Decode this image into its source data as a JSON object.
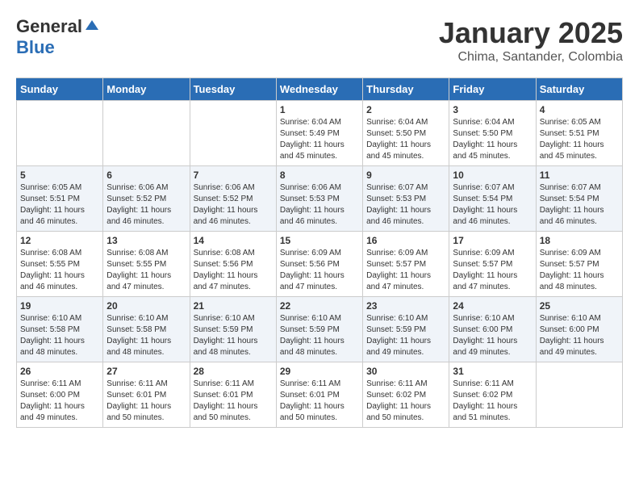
{
  "header": {
    "logo_general": "General",
    "logo_blue": "Blue",
    "title": "January 2025",
    "subtitle": "Chima, Santander, Colombia"
  },
  "days_of_week": [
    "Sunday",
    "Monday",
    "Tuesday",
    "Wednesday",
    "Thursday",
    "Friday",
    "Saturday"
  ],
  "weeks": [
    [
      {
        "day": "",
        "info": ""
      },
      {
        "day": "",
        "info": ""
      },
      {
        "day": "",
        "info": ""
      },
      {
        "day": "1",
        "info": "Sunrise: 6:04 AM\nSunset: 5:49 PM\nDaylight: 11 hours\nand 45 minutes."
      },
      {
        "day": "2",
        "info": "Sunrise: 6:04 AM\nSunset: 5:50 PM\nDaylight: 11 hours\nand 45 minutes."
      },
      {
        "day": "3",
        "info": "Sunrise: 6:04 AM\nSunset: 5:50 PM\nDaylight: 11 hours\nand 45 minutes."
      },
      {
        "day": "4",
        "info": "Sunrise: 6:05 AM\nSunset: 5:51 PM\nDaylight: 11 hours\nand 45 minutes."
      }
    ],
    [
      {
        "day": "5",
        "info": "Sunrise: 6:05 AM\nSunset: 5:51 PM\nDaylight: 11 hours\nand 46 minutes."
      },
      {
        "day": "6",
        "info": "Sunrise: 6:06 AM\nSunset: 5:52 PM\nDaylight: 11 hours\nand 46 minutes."
      },
      {
        "day": "7",
        "info": "Sunrise: 6:06 AM\nSunset: 5:52 PM\nDaylight: 11 hours\nand 46 minutes."
      },
      {
        "day": "8",
        "info": "Sunrise: 6:06 AM\nSunset: 5:53 PM\nDaylight: 11 hours\nand 46 minutes."
      },
      {
        "day": "9",
        "info": "Sunrise: 6:07 AM\nSunset: 5:53 PM\nDaylight: 11 hours\nand 46 minutes."
      },
      {
        "day": "10",
        "info": "Sunrise: 6:07 AM\nSunset: 5:54 PM\nDaylight: 11 hours\nand 46 minutes."
      },
      {
        "day": "11",
        "info": "Sunrise: 6:07 AM\nSunset: 5:54 PM\nDaylight: 11 hours\nand 46 minutes."
      }
    ],
    [
      {
        "day": "12",
        "info": "Sunrise: 6:08 AM\nSunset: 5:55 PM\nDaylight: 11 hours\nand 46 minutes."
      },
      {
        "day": "13",
        "info": "Sunrise: 6:08 AM\nSunset: 5:55 PM\nDaylight: 11 hours\nand 47 minutes."
      },
      {
        "day": "14",
        "info": "Sunrise: 6:08 AM\nSunset: 5:56 PM\nDaylight: 11 hours\nand 47 minutes."
      },
      {
        "day": "15",
        "info": "Sunrise: 6:09 AM\nSunset: 5:56 PM\nDaylight: 11 hours\nand 47 minutes."
      },
      {
        "day": "16",
        "info": "Sunrise: 6:09 AM\nSunset: 5:57 PM\nDaylight: 11 hours\nand 47 minutes."
      },
      {
        "day": "17",
        "info": "Sunrise: 6:09 AM\nSunset: 5:57 PM\nDaylight: 11 hours\nand 47 minutes."
      },
      {
        "day": "18",
        "info": "Sunrise: 6:09 AM\nSunset: 5:57 PM\nDaylight: 11 hours\nand 48 minutes."
      }
    ],
    [
      {
        "day": "19",
        "info": "Sunrise: 6:10 AM\nSunset: 5:58 PM\nDaylight: 11 hours\nand 48 minutes."
      },
      {
        "day": "20",
        "info": "Sunrise: 6:10 AM\nSunset: 5:58 PM\nDaylight: 11 hours\nand 48 minutes."
      },
      {
        "day": "21",
        "info": "Sunrise: 6:10 AM\nSunset: 5:59 PM\nDaylight: 11 hours\nand 48 minutes."
      },
      {
        "day": "22",
        "info": "Sunrise: 6:10 AM\nSunset: 5:59 PM\nDaylight: 11 hours\nand 48 minutes."
      },
      {
        "day": "23",
        "info": "Sunrise: 6:10 AM\nSunset: 5:59 PM\nDaylight: 11 hours\nand 49 minutes."
      },
      {
        "day": "24",
        "info": "Sunrise: 6:10 AM\nSunset: 6:00 PM\nDaylight: 11 hours\nand 49 minutes."
      },
      {
        "day": "25",
        "info": "Sunrise: 6:10 AM\nSunset: 6:00 PM\nDaylight: 11 hours\nand 49 minutes."
      }
    ],
    [
      {
        "day": "26",
        "info": "Sunrise: 6:11 AM\nSunset: 6:00 PM\nDaylight: 11 hours\nand 49 minutes."
      },
      {
        "day": "27",
        "info": "Sunrise: 6:11 AM\nSunset: 6:01 PM\nDaylight: 11 hours\nand 50 minutes."
      },
      {
        "day": "28",
        "info": "Sunrise: 6:11 AM\nSunset: 6:01 PM\nDaylight: 11 hours\nand 50 minutes."
      },
      {
        "day": "29",
        "info": "Sunrise: 6:11 AM\nSunset: 6:01 PM\nDaylight: 11 hours\nand 50 minutes."
      },
      {
        "day": "30",
        "info": "Sunrise: 6:11 AM\nSunset: 6:02 PM\nDaylight: 11 hours\nand 50 minutes."
      },
      {
        "day": "31",
        "info": "Sunrise: 6:11 AM\nSunset: 6:02 PM\nDaylight: 11 hours\nand 51 minutes."
      },
      {
        "day": "",
        "info": ""
      }
    ]
  ]
}
